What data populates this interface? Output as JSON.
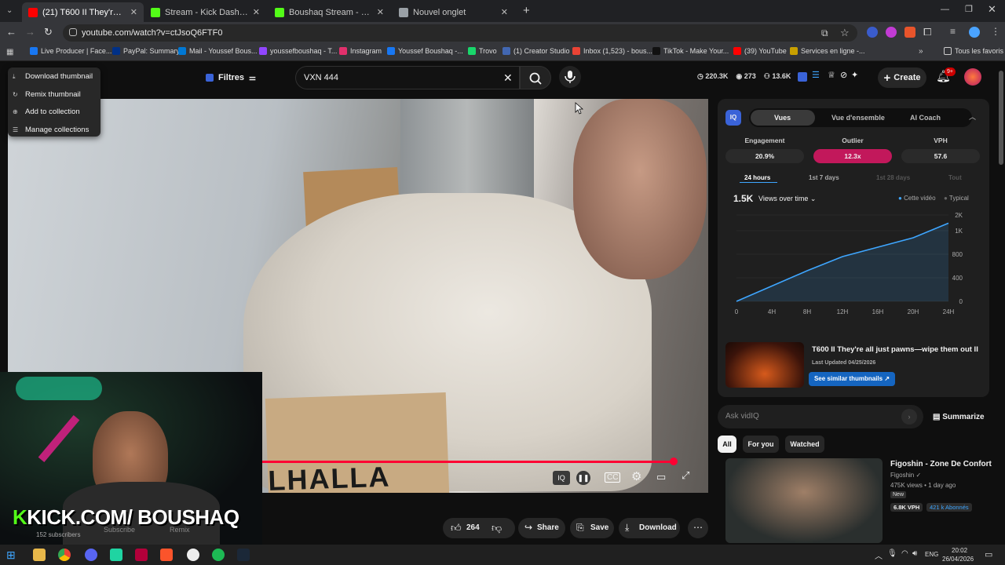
{
  "browser": {
    "tabs": [
      {
        "title": "(21) T600 II They're all just paw",
        "active": true,
        "color": "#ff0000"
      },
      {
        "title": "Stream - Kick Dashboard",
        "active": false,
        "color": "#53fc18"
      },
      {
        "title": "Boushaq Stream - Watch Live o",
        "active": false,
        "color": "#53fc18"
      },
      {
        "title": "Nouvel onglet",
        "active": false,
        "color": "#9aa0a6"
      }
    ],
    "url": "youtube.com/watch?v=ctJsoQ6FTF0",
    "bookmarks": [
      {
        "label": "Live Producer | Face...",
        "color": "#1877f2"
      },
      {
        "label": "PayPal: Summary",
        "color": "#003087"
      },
      {
        "label": "Mail - Youssef Bous...",
        "color": "#0078d4"
      },
      {
        "label": "youssefboushaq - T...",
        "color": "#9146ff"
      },
      {
        "label": "Instagram",
        "color": "#e1306c"
      },
      {
        "label": "Youssef Boushaq -...",
        "color": "#1877f2"
      },
      {
        "label": "Trovo",
        "color": "#19d66b"
      },
      {
        "label": "(1) Creator Studio",
        "color": "#4267b2"
      },
      {
        "label": "Inbox (1,523) - bous...",
        "color": "#ea4335"
      },
      {
        "label": "TikTok - Make Your...",
        "color": "#111111"
      },
      {
        "label": "(39) YouTube",
        "color": "#ff0000"
      },
      {
        "label": "Services en ligne -...",
        "color": "#c8a000"
      }
    ],
    "all_bookmarks": "Tous les favoris"
  },
  "context_menu": {
    "items": [
      "Download thumbnail",
      "Remix thumbnail",
      "Add to collection",
      "Manage collections"
    ]
  },
  "header": {
    "filters_label": "Filtres",
    "search_value": "VXN 444",
    "stats": [
      "220.3K",
      "273",
      "13.6K"
    ],
    "create_label": "Create",
    "notif_badge": "9+"
  },
  "video": {
    "sign_text": "LHALLA",
    "overlay_text": "KICK.COM/ BOUSHAQ",
    "subscribers": "152 subscribers",
    "subscribe_label": "Subscribe",
    "remix_label": "Remix"
  },
  "actions": {
    "likes": "264",
    "share": "Share",
    "save": "Save",
    "download": "Download"
  },
  "vidiq": {
    "tabs": [
      "Vues",
      "Vue d'ensemble",
      "AI Coach"
    ],
    "metrics": [
      {
        "label": "Engagement",
        "value": "20.9%"
      },
      {
        "label": "Outlier",
        "value": "12.3x"
      },
      {
        "label": "VPH",
        "value": "57.6"
      }
    ],
    "ranges": [
      "24 hours",
      "1st 7 days",
      "1st 28 days",
      "Tout"
    ],
    "views_total": "1.5K",
    "views_dropdown": "Views over time",
    "legend": [
      "Cette vidéo",
      "Typical"
    ],
    "related_title": "T600 II They're all just pawns—wipe them out II",
    "last_updated": "Last Updated 04/25/2026",
    "similar_button": "See similar thumbnails",
    "ask_placeholder": "Ask vidIQ",
    "summarize": "Summarize"
  },
  "chart_data": {
    "type": "line",
    "x": [
      "0",
      "4H",
      "8H",
      "12H",
      "16H",
      "20H",
      "24H"
    ],
    "y_ticks": [
      "0",
      "400",
      "800",
      "1K",
      "2K"
    ],
    "series": [
      {
        "values": [
          0,
          260,
          520,
          760,
          860,
          940,
          1480
        ]
      }
    ],
    "colors": {
      "line": "#3ea6ff"
    }
  },
  "feed": {
    "chips": [
      "All",
      "For you",
      "Watched"
    ],
    "item": {
      "title": "Figoshin - Zone De Confort",
      "channel": "Figoshin",
      "meta": "475K views • 1 day ago",
      "badge": "New",
      "vph": "6.8K VPH",
      "subs": "421 k Abonnés"
    }
  },
  "taskbar": {
    "lang": "ENG",
    "time": "20:02",
    "date": "26/04/2026"
  }
}
